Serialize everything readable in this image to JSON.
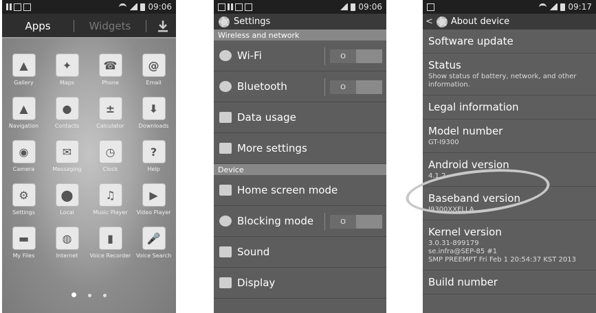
{
  "screen1": {
    "status_time": "09:06",
    "tabs": {
      "apps": "Apps",
      "widgets": "Widgets"
    },
    "apps": [
      {
        "label": "Gallery",
        "icon": "gallery-icon",
        "glyph": "▲"
      },
      {
        "label": "Maps",
        "icon": "maps-icon",
        "glyph": "✦"
      },
      {
        "label": "Phone",
        "icon": "phone-icon",
        "glyph": "☎"
      },
      {
        "label": "Email",
        "icon": "email-icon",
        "glyph": "@"
      },
      {
        "label": "Navigation",
        "icon": "navigation-icon",
        "glyph": "▲"
      },
      {
        "label": "Contacts",
        "icon": "contacts-icon",
        "glyph": "●"
      },
      {
        "label": "Calculator",
        "icon": "calculator-icon",
        "glyph": "±"
      },
      {
        "label": "Downloads",
        "icon": "downloads-icon",
        "glyph": "⬇"
      },
      {
        "label": "Camera",
        "icon": "camera-icon",
        "glyph": "◉"
      },
      {
        "label": "Messaging",
        "icon": "messaging-icon",
        "glyph": "✉"
      },
      {
        "label": "Clock",
        "icon": "clock-icon",
        "glyph": "◷"
      },
      {
        "label": "Help",
        "icon": "help-icon",
        "glyph": "?"
      },
      {
        "label": "Settings",
        "icon": "settings-icon",
        "glyph": "⚙"
      },
      {
        "label": "Local",
        "icon": "local-icon",
        "glyph": "⬤"
      },
      {
        "label": "Music Player",
        "icon": "music-player-icon",
        "glyph": "♫"
      },
      {
        "label": "Video Player",
        "icon": "video-player-icon",
        "glyph": "▶"
      },
      {
        "label": "My Files",
        "icon": "my-files-icon",
        "glyph": "▬"
      },
      {
        "label": "Internet",
        "icon": "internet-icon",
        "glyph": "◍"
      },
      {
        "label": "Voice Recorder",
        "icon": "voice-recorder-icon",
        "glyph": "▮"
      },
      {
        "label": "Voice Search",
        "icon": "voice-search-icon",
        "glyph": "🎤"
      }
    ]
  },
  "screen2": {
    "status_time": "09:06",
    "title": "Settings",
    "section_wireless": "Wireless and network",
    "wifi": "Wi-Fi",
    "bluetooth": "Bluetooth",
    "data_usage": "Data usage",
    "more_settings": "More settings",
    "section_device": "Device",
    "home_screen_mode": "Home screen mode",
    "blocking_mode": "Blocking mode",
    "sound": "Sound",
    "display": "Display",
    "toggle_off": "O"
  },
  "screen3": {
    "status_time": "09:17",
    "title": "About device",
    "items": [
      {
        "title": "Software update",
        "sub": ""
      },
      {
        "title": "Status",
        "sub": "Show status of battery, network, and other information."
      },
      {
        "title": "Legal information",
        "sub": ""
      },
      {
        "title": "Model number",
        "sub": "GT-I9300"
      },
      {
        "title": "Android version",
        "sub": "4.1.2"
      },
      {
        "title": "Baseband version",
        "sub": "I9300XXELLA"
      },
      {
        "title": "Kernel version",
        "sub": "3.0.31-899179\nse.infra@SEP-85 #1\nSMP PREEMPT Fri Feb 1 20:54:37 KST 2013"
      },
      {
        "title": "Build number",
        "sub": ""
      }
    ]
  }
}
